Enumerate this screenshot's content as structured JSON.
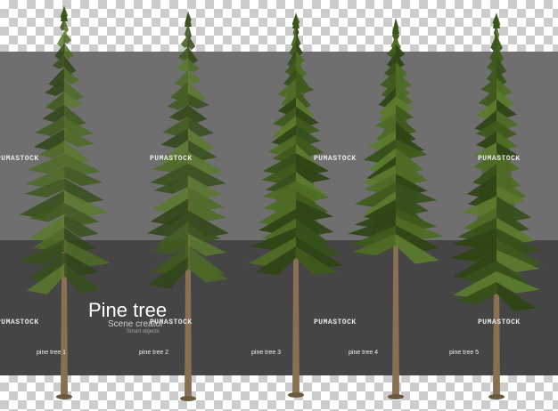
{
  "title": "Pine tree",
  "subtitle": "Scene creator",
  "subtitle_small": "Smart objects",
  "watermark": "PUMASTOCK",
  "tree_labels": [
    "pine tree 1",
    "pine tree 2",
    "pine tree 3",
    "pine tree 4",
    "pine tree 5"
  ],
  "colors": {
    "upper_band": "#6f6f6f",
    "lower_band": "#454545",
    "foliage": "#3f5a1c",
    "trunk": "#8a7052"
  }
}
